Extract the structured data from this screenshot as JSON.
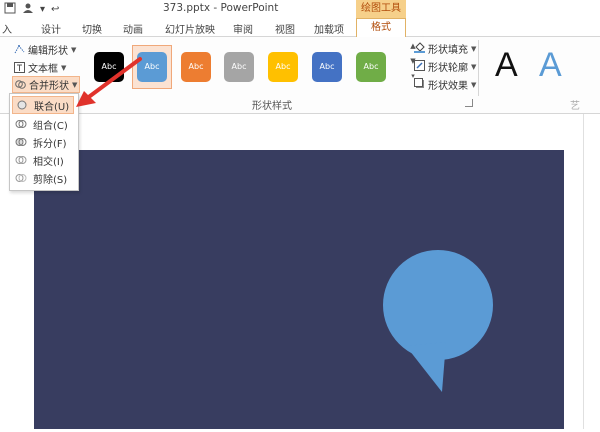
{
  "window": {
    "title": "373.pptx - PowerPoint",
    "context_tab_group": "绘图工具"
  },
  "qat": {
    "undo_glyph": "↩",
    "dropdown_glyph": "▾"
  },
  "tabs": [
    {
      "label": "入"
    },
    {
      "label": "设计"
    },
    {
      "label": "切换"
    },
    {
      "label": "动画"
    },
    {
      "label": "幻灯片放映"
    },
    {
      "label": "审阅"
    },
    {
      "label": "视图"
    },
    {
      "label": "加载项"
    },
    {
      "label": "格式"
    }
  ],
  "ribbon": {
    "insert_shapes": {
      "edit_shape": "编辑形状",
      "text_box": "文本框",
      "merge_shapes": "合并形状"
    },
    "shape_styles_label": "形状样式",
    "swatch_text": "Abc",
    "swatches": [
      {
        "color": "#000000"
      },
      {
        "color": "#5b9bd5"
      },
      {
        "color": "#ed7d31"
      },
      {
        "color": "#a5a5a5"
      },
      {
        "color": "#ffc000"
      },
      {
        "color": "#4472c4"
      },
      {
        "color": "#70ad47"
      }
    ],
    "shape_fill": "形状填充",
    "shape_outline": "形状轮廓",
    "shape_effects": "形状效果",
    "art_label": "艺",
    "art_letters": [
      "A",
      "A"
    ]
  },
  "merge_menu": {
    "items": [
      {
        "label": "联合(U)"
      },
      {
        "label": "组合(C)"
      },
      {
        "label": "拆分(F)"
      },
      {
        "label": "相交(I)"
      },
      {
        "label": "剪除(S)"
      }
    ]
  },
  "slide": {
    "background": "#383d60",
    "callout_color": "#5b9bd5"
  },
  "colors": {
    "accent": "#b14d0b",
    "highlight": "#fbdcc6",
    "arrow": "#e0322b"
  }
}
